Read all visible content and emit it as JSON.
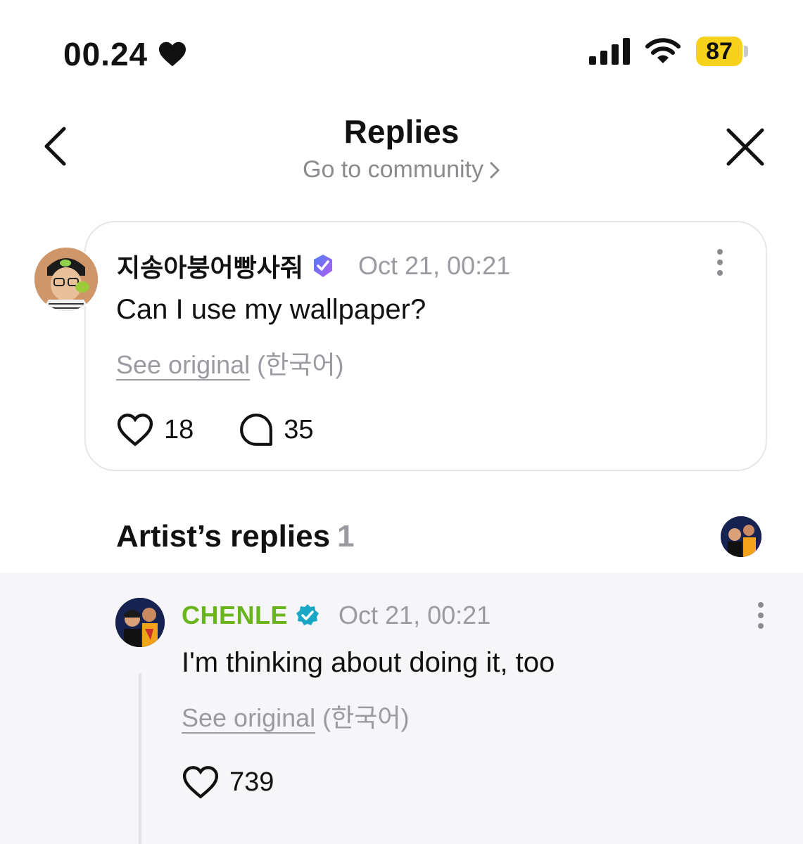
{
  "status_bar": {
    "time": "00.24",
    "heart_icon": "heart-icon",
    "battery": "87",
    "colors": {
      "battery": "#f7d21c"
    }
  },
  "header": {
    "title": "Replies",
    "subtitle": "Go to community"
  },
  "post": {
    "author": "지송아붕어빵사줘",
    "timestamp": "Oct 21, 00:21",
    "text": "Can I use my wallpaper?",
    "see_original": "See original",
    "language": "(한국어)",
    "likes": "18",
    "comments": "35",
    "badge_color": "#7a5cf0"
  },
  "artist_replies": {
    "title": "Artist’s replies",
    "count": "1",
    "items": [
      {
        "author": "CHENLE",
        "timestamp": "Oct 21, 00:21",
        "text": "I'm thinking about doing it, too",
        "see_original": "See original",
        "language": "(한국어)",
        "likes": "739",
        "name_color": "#6ab41e",
        "badge_color": "#1aa7c6"
      }
    ]
  }
}
